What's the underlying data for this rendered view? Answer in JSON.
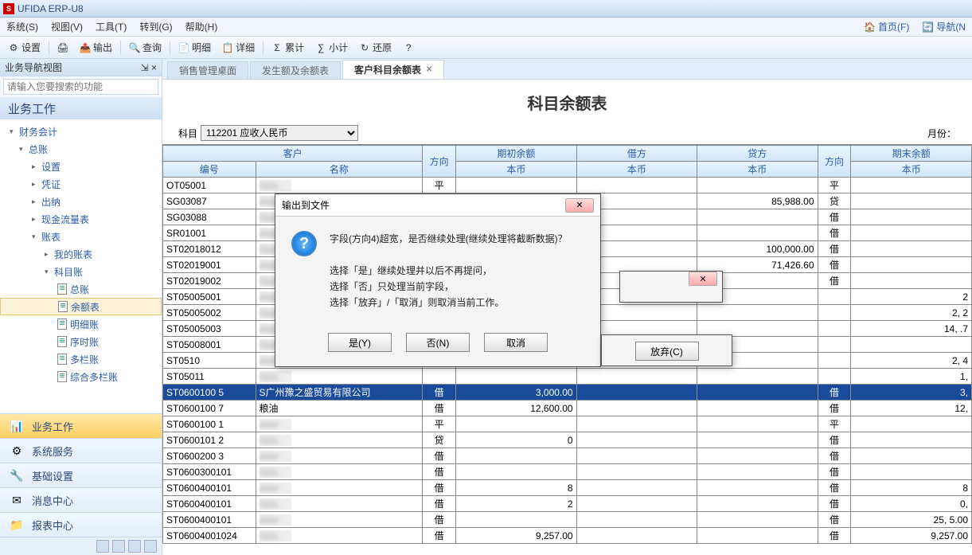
{
  "title": "UFIDA ERP-U8",
  "menu": {
    "items": [
      "系统(S)",
      "视图(V)",
      "工具(T)",
      "转到(G)",
      "帮助(H)"
    ],
    "right": [
      "首页(F)",
      "导航(N"
    ]
  },
  "toolbar": [
    {
      "icon": "⚙",
      "label": "设置"
    },
    {
      "sep": true
    },
    {
      "icon": "🖨",
      "label": ""
    },
    {
      "icon": "📤",
      "label": "输出"
    },
    {
      "sep": true
    },
    {
      "icon": "🔍",
      "label": "查询"
    },
    {
      "sep": true
    },
    {
      "icon": "📄",
      "label": "明细"
    },
    {
      "icon": "📋",
      "label": "详细"
    },
    {
      "sep": true
    },
    {
      "icon": "Σ",
      "label": "累计"
    },
    {
      "icon": "∑",
      "label": "小计"
    },
    {
      "icon": "↻",
      "label": "还原"
    },
    {
      "icon": "?",
      "label": ""
    }
  ],
  "sidebar": {
    "header": "业务导航视图",
    "pin": "⇲",
    "close": "×",
    "search_ph": "请输入您要搜索的功能",
    "title": "业务工作",
    "tree": [
      {
        "l": 0,
        "a": "▾",
        "t": "财务会计"
      },
      {
        "l": 1,
        "a": "▾",
        "t": "总账"
      },
      {
        "l": 2,
        "a": "▸",
        "t": "设置"
      },
      {
        "l": 2,
        "a": "▸",
        "t": "凭证"
      },
      {
        "l": 2,
        "a": "▸",
        "t": "出纳"
      },
      {
        "l": 2,
        "a": "▸",
        "t": "现金流量表"
      },
      {
        "l": 2,
        "a": "▾",
        "t": "账表"
      },
      {
        "l": 3,
        "a": "▸",
        "t": "我的账表"
      },
      {
        "l": 3,
        "a": "▾",
        "t": "科目账"
      },
      {
        "l": 4,
        "doc": true,
        "t": "总账"
      },
      {
        "l": 4,
        "doc": true,
        "t": "余额表",
        "sel": true
      },
      {
        "l": 4,
        "doc": true,
        "t": "明细账"
      },
      {
        "l": 4,
        "doc": true,
        "t": "序时账"
      },
      {
        "l": 4,
        "doc": true,
        "t": "多栏账"
      },
      {
        "l": 4,
        "doc": true,
        "t": "综合多栏账"
      }
    ],
    "panels": [
      {
        "icon": "📊",
        "label": "业务工作",
        "active": true
      },
      {
        "icon": "⚙",
        "label": "系统服务"
      },
      {
        "icon": "🔧",
        "label": "基础设置"
      },
      {
        "icon": "✉",
        "label": "消息中心"
      },
      {
        "icon": "📁",
        "label": "报表中心"
      }
    ]
  },
  "tabs": [
    {
      "label": "销售管理桌面",
      "x": false
    },
    {
      "label": "发生额及余额表",
      "x": false
    },
    {
      "label": "客户科目余额表",
      "x": true,
      "active": true
    }
  ],
  "report": {
    "title": "科目余额表",
    "subject_label": "科目",
    "subject_value": "112201 应收人民币",
    "month_label": "月份：",
    "cols": {
      "customer": "客户",
      "code": "编号",
      "name": "名称",
      "dir1": "方向",
      "open": "期初余额",
      "local": "本币",
      "debit": "借方",
      "credit": "贷方",
      "dir2": "方向",
      "close": "期末余额"
    },
    "rows": [
      {
        "code": "OT05001",
        "name": "",
        "d1": "平",
        "open": "",
        "debit": "",
        "credit": "",
        "d2": "平",
        "close": ""
      },
      {
        "code": "SG03087",
        "name": "",
        "d1": "",
        "open": "",
        "debit": "",
        "credit": "85,988.00",
        "d2": "贷",
        "close": ""
      },
      {
        "code": "SG03088",
        "name": "",
        "d1": "",
        "open": "",
        "debit": "",
        "credit": "",
        "d2": "借",
        "close": ""
      },
      {
        "code": "SR01001",
        "name": "",
        "d1": "",
        "open": "",
        "debit": "",
        "credit": "",
        "d2": "借",
        "close": ""
      },
      {
        "code": "ST02018012",
        "name": "",
        "d1": "",
        "open": "",
        "debit": "",
        "credit": "100,000.00",
        "d2": "借",
        "close": ""
      },
      {
        "code": "ST02019001",
        "name": "",
        "d1": "",
        "open": "",
        "debit": "",
        "credit": "71,426.60",
        "d2": "借",
        "close": ""
      },
      {
        "code": "ST02019002",
        "name": "",
        "d1": "",
        "open": "",
        "debit": "",
        "credit": "",
        "d2": "借",
        "close": ""
      },
      {
        "code": "ST05005001",
        "name": "",
        "d1": "",
        "open": "",
        "debit": "",
        "credit": "",
        "d2": "",
        "close": "2"
      },
      {
        "code": "ST05005002",
        "name": "",
        "d1": "",
        "open": "",
        "debit": "",
        "credit": "",
        "d2": "",
        "close": "2,    2"
      },
      {
        "code": "ST05005003",
        "name": "",
        "d1": "",
        "open": "",
        "debit": "",
        "credit": "",
        "d2": "",
        "close": "14,   .7"
      },
      {
        "code": "ST05008001",
        "name": "",
        "d1": "",
        "open": "",
        "debit": "",
        "credit": "",
        "d2": "",
        "close": ""
      },
      {
        "code": "ST0510",
        "name": "",
        "d1": "",
        "open": "",
        "debit": "",
        "credit": "",
        "d2": "",
        "close": "2,    4"
      },
      {
        "code": "ST05011",
        "name": "",
        "d1": "",
        "open": "",
        "debit": "",
        "credit": "",
        "d2": "",
        "close": "1,"
      },
      {
        "code": "ST0600100   5",
        "name": "S广州豫之盛贸易有限公司",
        "d1": "借",
        "open": "3,000.00",
        "debit": "",
        "credit": "",
        "d2": "借",
        "close": "3,",
        "sel": true
      },
      {
        "code": "ST0600100   7",
        "name": "粮油",
        "d1": "借",
        "open": "12,600.00",
        "debit": "",
        "credit": "",
        "d2": "借",
        "close": "12,"
      },
      {
        "code": "ST0600100   1",
        "name": "",
        "d1": "平",
        "open": "",
        "debit": "",
        "credit": "",
        "d2": "平",
        "close": ""
      },
      {
        "code": "ST0600101   2",
        "name": "",
        "d1": "贷",
        "open": "0",
        "debit": "",
        "credit": "",
        "d2": "借",
        "close": ""
      },
      {
        "code": "ST0600200   3",
        "name": "",
        "d1": "借",
        "open": "",
        "debit": "",
        "credit": "",
        "d2": "借",
        "close": ""
      },
      {
        "code": "ST0600300101",
        "name": "",
        "d1": "借",
        "open": "",
        "debit": "",
        "credit": "",
        "d2": "借",
        "close": ""
      },
      {
        "code": "ST0600400101",
        "name": "",
        "d1": "借",
        "open": "8",
        "debit": "",
        "credit": "",
        "d2": "借",
        "close": "8"
      },
      {
        "code": "ST0600400101",
        "name": "",
        "d1": "借",
        "open": "2",
        "debit": "",
        "credit": "",
        "d2": "借",
        "close": "0,"
      },
      {
        "code": "ST0600400101",
        "name": "",
        "d1": "借",
        "open": "",
        "debit": "",
        "credit": "",
        "d2": "借",
        "close": "25,   5.00"
      },
      {
        "code": "ST06004001024",
        "name": "",
        "d1": "借",
        "open": "9,257.00",
        "debit": "",
        "credit": "",
        "d2": "借",
        "close": "9,257.00"
      }
    ]
  },
  "dialog": {
    "title": "输出到文件",
    "msg1": "字段(方向4)超宽，是否继续处理(继续处理将截断数据)？",
    "msg2": "选择「是」继续处理并以后不再提问，",
    "msg3": "选择「否」只处理当前字段，",
    "msg4": "选择「放弃」/「取消」则取消当前工作。",
    "b1": "是(Y)",
    "b2": "否(N)",
    "b3": "取消",
    "abandon": "放弃(C)"
  }
}
